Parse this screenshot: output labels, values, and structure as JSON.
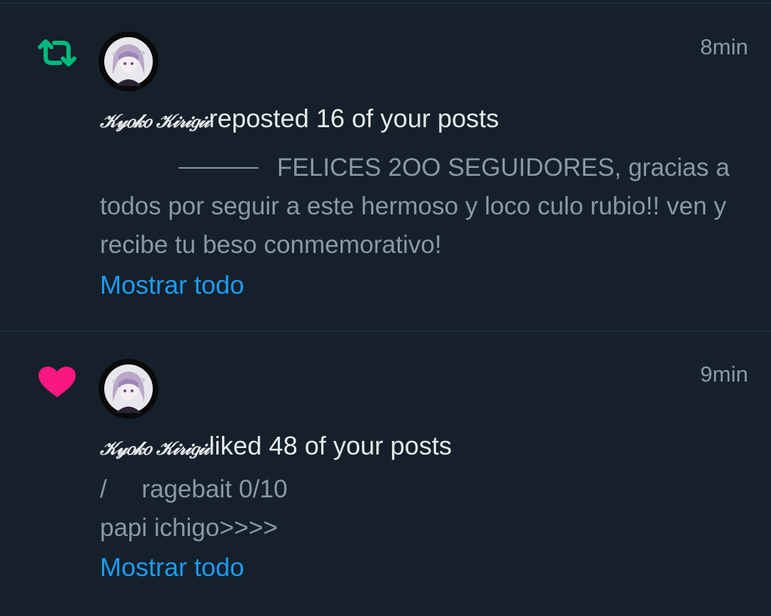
{
  "notifications": [
    {
      "type_icon": "repost-icon",
      "icon_color": "#00ba7c",
      "time": "8min",
      "username": "𝒦𝓎𝑜𝓀𝑜 𝒦𝒾𝓇𝒾𝑔𝒾𝒾",
      "action": "reposted 16 of your posts",
      "snippet_lines": [
        "FELICES 2OO SEGUIDORES, gracias a todos por seguir a este hermoso y loco culo rubio!! ven y recibe tu beso conmemorativo!"
      ],
      "show_all": "Mostrar todo"
    },
    {
      "type_icon": "heart-icon",
      "icon_color": "#f91880",
      "time": "9min",
      "username": "𝒦𝓎𝑜𝓀𝑜 𝒦𝒾𝓇𝒾𝑔𝒾𝒾",
      "action": "liked 48 of your posts",
      "snippet_lines": [
        "/     ragebait 0/10",
        "papi ichigo>>>>"
      ],
      "show_all": "Mostrar todo"
    }
  ]
}
